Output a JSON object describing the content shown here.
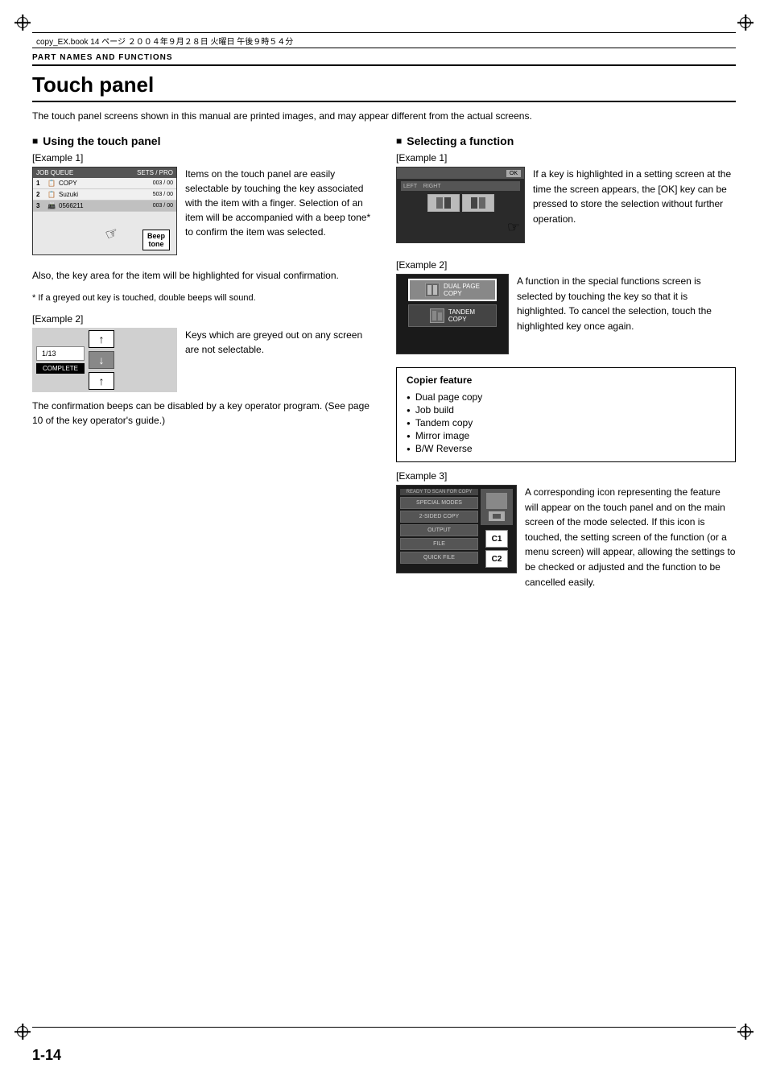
{
  "meta": {
    "file_info": "copy_EX.book  14 ページ  ２００４年９月２８日  火曜日  午後９時５４分",
    "section": "PART NAMES AND FUNCTIONS"
  },
  "title": "Touch panel",
  "intro": "The touch panel screens shown in this manual are printed images, and may appear different from the actual screens.",
  "left_column": {
    "section_title": "Using the touch panel",
    "example1_label": "[Example 1]",
    "example1_desc": "Items on the touch panel are easily selectable by touching the key associated with the item with a finger. Selection of an item will be accompanied with a beep tone* to confirm the item was selected.",
    "example1_note": "Also, the key area for the item will be highlighted for visual confirmation.",
    "example1_footnote": "* If a greyed out key is touched, double beeps will sound.",
    "beep_label": "Beep\ntone",
    "example2_label": "[Example 2]",
    "example2_desc": "Keys which are greyed out on any screen are not selectable.",
    "page_indicator": "1/13",
    "complete_label": "COMPLETE",
    "confirmation_text": "The confirmation beeps can be disabled by a key operator program. (See page 10 of the key operator's guide.)",
    "job_queue_header": "JOB QUEUE",
    "sets_pro_header": "SETS / PRO",
    "job1_name": "COPY",
    "job1_sets": "003 / 00",
    "job2_name": "Suzuki",
    "job2_sets": "503 / 00",
    "job3_name": "0566211",
    "job3_sets": "003 / 00"
  },
  "right_column": {
    "section_title": "Selecting a function",
    "example1_label": "[Example 1]",
    "example1_desc": "If a key is highlighted in a setting screen at the time the screen appears, the [OK] key can be pressed to store the selection without further operation.",
    "example2_label": "[Example 2]",
    "example2_desc": "A function in the special functions screen is selected by touching the key so that it is highlighted. To cancel the selection, touch the highlighted key once again.",
    "dual_page_copy": "DUAL PAGE\nCOPY",
    "tandem_copy": "TANDEM\nCOPY",
    "feature_box_title": "Copier feature",
    "features": [
      "Dual page copy",
      "Job build",
      "Tandem copy",
      "Mirror image",
      "B/W Reverse"
    ],
    "example3_label": "[Example 3]",
    "example3_desc": "A corresponding icon representing the feature will appear on the touch panel and on the main screen of the mode selected. If this icon is touched, the setting screen of the function (or a menu screen) will appear, allowing the settings to be checked or adjusted and the function to be cancelled easily.",
    "ready_label": "READY TO SCAN FOR COPY",
    "special_modes": "SPECIAL MODES",
    "sided_copy": "2-SIDED COPY",
    "output": "OUTPUT",
    "file": "FILE",
    "quick_file": "QUICK FILE",
    "c1_label": "C1",
    "c2_label": "C2"
  },
  "page_number": "1-14"
}
